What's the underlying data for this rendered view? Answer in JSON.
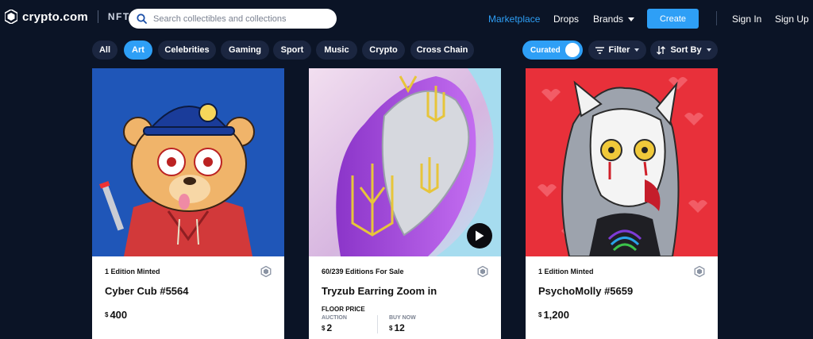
{
  "brand": {
    "name": "crypto.com",
    "product": "NFT"
  },
  "search": {
    "placeholder": "Search collectibles and collections",
    "value": ""
  },
  "nav": {
    "marketplace": "Marketplace",
    "drops": "Drops",
    "brands": "Brands",
    "create": "Create",
    "sign_in": "Sign In",
    "sign_up": "Sign Up"
  },
  "categories": [
    "All",
    "Art",
    "Celebrities",
    "Gaming",
    "Sport",
    "Music",
    "Crypto",
    "Cross Chain"
  ],
  "active_category": "Art",
  "controls": {
    "curated": "Curated",
    "curated_on": true,
    "filter": "Filter",
    "sort": "Sort By"
  },
  "cards": [
    {
      "edition": "1 Edition Minted",
      "title": "Cyber Cub #5564",
      "currency": "$",
      "price": "400"
    },
    {
      "edition": "60/239 Editions For Sale",
      "title": "Tryzub Earring Zoom in",
      "floor_label": "FLOOR PRICE",
      "auction_label": "AUCTION",
      "auction_currency": "$",
      "auction_price": "2",
      "buynow_label": "BUY NOW",
      "buynow_currency": "$",
      "buynow_price": "12",
      "has_video": true
    },
    {
      "edition": "1 Edition Minted",
      "title": "PsychoMolly #5659",
      "currency": "$",
      "price": "1,200"
    }
  ],
  "colors": {
    "accent": "#2e9ff6",
    "background": "#0b1426",
    "chip": "#1b2640"
  }
}
